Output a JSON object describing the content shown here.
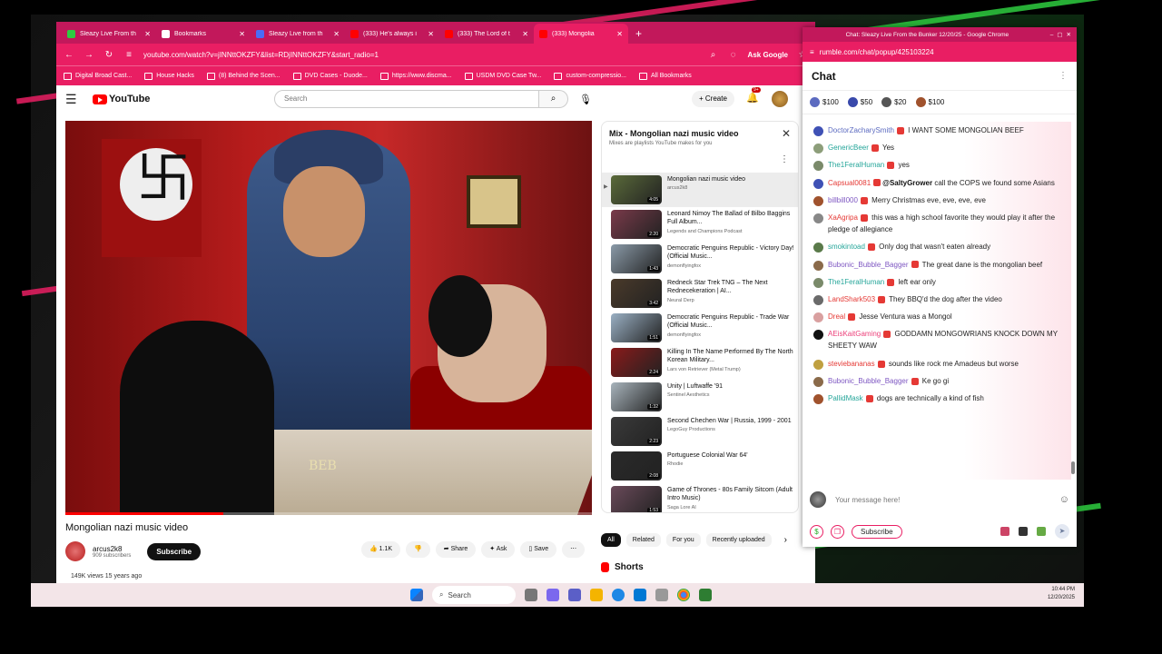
{
  "youtube": {
    "tabs": [
      {
        "label": "Sleazy Live From th",
        "color": "#2ecc40",
        "active": false
      },
      {
        "label": "Bookmarks",
        "color": "#ffffff",
        "active": false
      },
      {
        "label": "Sleazy Live from th",
        "color": "#4a6cf7",
        "active": false
      },
      {
        "label": "(333) He's always i",
        "color": "#ff0000",
        "active": false
      },
      {
        "label": "(333) The Lord of t",
        "color": "#ff0000",
        "active": false
      },
      {
        "label": "(333) Mongolia",
        "color": "#ff0000",
        "active": true
      }
    ],
    "new_tab": "+",
    "url": "youtube.com/watch?v=jINNttOKZFY&list=RDjINNttOKZFY&start_radio=1",
    "ask_google": "Ask Google",
    "bookmarks": [
      "Digital Broad Cast...",
      "House Hacks",
      "(8) Behind the Scen...",
      "DVD Cases - Duode...",
      "https://www.discma...",
      "USDM DVD Case Tw...",
      "custom-compressio...",
      "All Bookmarks"
    ],
    "logo_text": "YouTube",
    "search_placeholder": "Search",
    "create_label": "+ Create",
    "notif_count": "9+",
    "video_caption": "BEB",
    "video_title": "Mongolian nazi music video",
    "channel_name": "arcus2k8",
    "channel_subs": "909 subscribers",
    "subscribe": "Subscribe",
    "like_count": "1.1K",
    "share": "Share",
    "ask": "Ask",
    "save": "Save",
    "views": "149K views  15 years ago",
    "mix_title": "Mix - Mongolian nazi music video",
    "mix_sub": "Mixes are playlists YouTube makes for you",
    "playlist": [
      {
        "title": "Mongolian nazi music video",
        "channel": "arcus2k8",
        "duration": "4:05",
        "thumb": "#5a6a3a"
      },
      {
        "title": "Leonard Nimoy The Ballad of Bilbo Baggins Full Album...",
        "channel": "Legends and Champions Podcast",
        "duration": "2:20",
        "thumb": "#7a3a4a"
      },
      {
        "title": "Democratic Penguins Republic - Victory Day! (Official Music...",
        "channel": "demonflyingfox",
        "duration": "1:43",
        "thumb": "#8a9aa8"
      },
      {
        "title": "Redneck Star Trek TNG – The Next Rednecekeration | AI...",
        "channel": "Neural Derp",
        "duration": "3:42",
        "thumb": "#4a3a2a"
      },
      {
        "title": "Democratic Penguins Republic - Trade War (Official Music...",
        "channel": "demonflyingfox",
        "duration": "1:51",
        "thumb": "#9ab0c4"
      },
      {
        "title": "Killing In The Name Performed By The North Korean Military...",
        "channel": "Lars von Retriever (Metal Trump)",
        "duration": "2:24",
        "thumb": "#8a1a1a"
      },
      {
        "title": "Unity | Luftwaffe '91",
        "channel": "Sentinel Aesthetics",
        "duration": "1:32",
        "thumb": "#a8b4bc"
      },
      {
        "title": "Second Chechen War | Russia, 1999 - 2001",
        "channel": "LegoGuy Productions",
        "duration": "2:23",
        "thumb": "#3a3a3a"
      },
      {
        "title": "Portuguese Colonial War 64'",
        "channel": "Rhodie",
        "duration": "2:08",
        "thumb": "#2a2a2a"
      },
      {
        "title": "Game of Thrones - 80s Family Sitcom (Adult Intro Music)",
        "channel": "Saga Lore AI",
        "duration": "1:53",
        "thumb": "#6a4a5a"
      }
    ],
    "chips": [
      "All",
      "Related",
      "For you",
      "Recently uploaded"
    ],
    "shorts": "Shorts"
  },
  "chat": {
    "window_title": "Chat: Sleazy Live From the Bunker 12/20/25 - Google Chrome",
    "url": "rumble.com/chat/popup/425103224",
    "header": "Chat",
    "rants": [
      {
        "amount": "$100",
        "color": "#5c6bc0"
      },
      {
        "amount": "$50",
        "color": "#3949ab"
      },
      {
        "amount": "$20",
        "color": "#555555"
      },
      {
        "amount": "$100",
        "color": "#a0522d"
      }
    ],
    "messages": [
      {
        "user": "DoctorZacharySmith",
        "text": "I WANT SOME MONGOLIAN BEEF",
        "color": "#5c6bc0",
        "avatar": "#3f51b5"
      },
      {
        "user": "GenericBeer",
        "text": "Yes",
        "color": "#26a69a",
        "avatar": "#8d9e7a"
      },
      {
        "user": "The1FeralHuman",
        "text": "yes",
        "color": "#26a69a",
        "avatar": "#7a8a6a"
      },
      {
        "user": "Capsual0081",
        "mention": "@SaltyGrower",
        "text": "call the COPS we found some Asians",
        "color": "#e53935",
        "avatar": "#3f51b5"
      },
      {
        "user": "billbill000",
        "text": "Merry Christmas eve, eve, eve, eve",
        "color": "#7e57c2",
        "avatar": "#a0522d"
      },
      {
        "user": "XaAgripa",
        "text": "this was a high school favorite they would play it after the pledge of allegiance",
        "color": "#e53935",
        "avatar": "#888888"
      },
      {
        "user": "smokintoad",
        "text": "Only dog that wasn't eaten already",
        "color": "#26a69a",
        "avatar": "#5a7a4a"
      },
      {
        "user": "Bubonic_Bubble_Bagger",
        "text": "The great dane is the mongolian beef",
        "color": "#7e57c2",
        "avatar": "#8a6a4a"
      },
      {
        "user": "The1FeralHuman",
        "text": "left ear only",
        "color": "#26a69a",
        "avatar": "#7a8a6a"
      },
      {
        "user": "LandShark503",
        "text": "They BBQ'd the dog after the video",
        "color": "#e53935",
        "avatar": "#6a6a6a"
      },
      {
        "user": "Dreal",
        "text": "Jesse Ventura was a Mongol",
        "color": "#e53935",
        "avatar": "#d9a0a0"
      },
      {
        "user": "AEisKaitGaming",
        "text": "GODDAMN MONGOWRIANS KNOCK DOWN MY SHEETY WAW",
        "color": "#ec407a",
        "avatar": "#111111"
      },
      {
        "user": "steviebananas",
        "text": "sounds like rock me Amadeus but worse",
        "color": "#e53935",
        "avatar": "#c0a040"
      },
      {
        "user": "Bubonic_Bubble_Bagger",
        "text": "Ke go gi",
        "color": "#7e57c2",
        "avatar": "#8a6a4a"
      },
      {
        "user": "PallidMask",
        "text": "dogs are technically a kind of fish",
        "color": "#26a69a",
        "avatar": "#a0522d"
      }
    ],
    "composer_placeholder": "Your message here!",
    "subscribe": "Subscribe"
  },
  "taskbar": {
    "search": "Search",
    "time": "10:44 PM",
    "date": "12/20/2025"
  },
  "colors": {
    "accent": "#e91e63",
    "accent_dark": "#c2185b",
    "yt_red": "#ff0000"
  },
  "icons": [
    "back-icon",
    "forward-icon",
    "reload-icon",
    "search-icon",
    "mic-icon",
    "bell-icon",
    "close-icon",
    "like-icon",
    "dislike-icon",
    "share-icon",
    "save-icon",
    "emoji-icon",
    "send-icon",
    "windows-icon"
  ]
}
